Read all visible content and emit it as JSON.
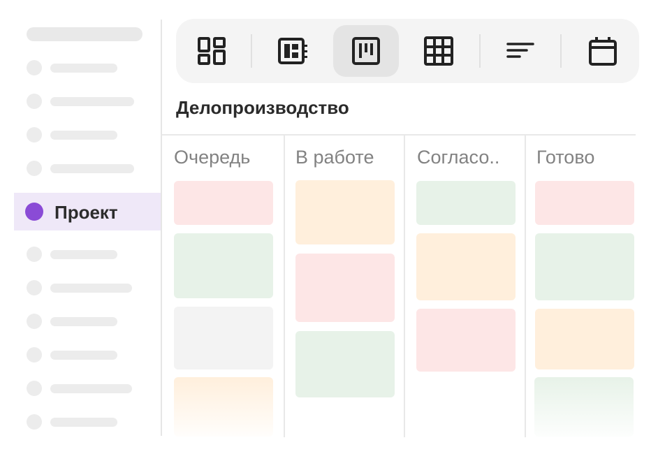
{
  "sidebar": {
    "active_item": {
      "label": "Проект",
      "color": "#8a4bd6"
    }
  },
  "toolbar": {
    "buttons": [
      {
        "icon": "dashboard-icon"
      },
      {
        "icon": "card-view-icon"
      },
      {
        "icon": "kanban-icon",
        "active": true
      },
      {
        "icon": "grid-table-icon"
      },
      {
        "icon": "sort-icon"
      },
      {
        "icon": "calendar-icon"
      }
    ]
  },
  "board": {
    "title": "Делопроизводство",
    "columns": [
      {
        "title": "Очередь"
      },
      {
        "title": "В работе"
      },
      {
        "title": "Согласо.."
      },
      {
        "title": "Готово"
      }
    ]
  },
  "colors": {
    "card_pink": "#fde6e6",
    "card_green": "#e7f2e8",
    "card_orange": "#ffefdc",
    "card_gray": "#f3f3f3"
  }
}
